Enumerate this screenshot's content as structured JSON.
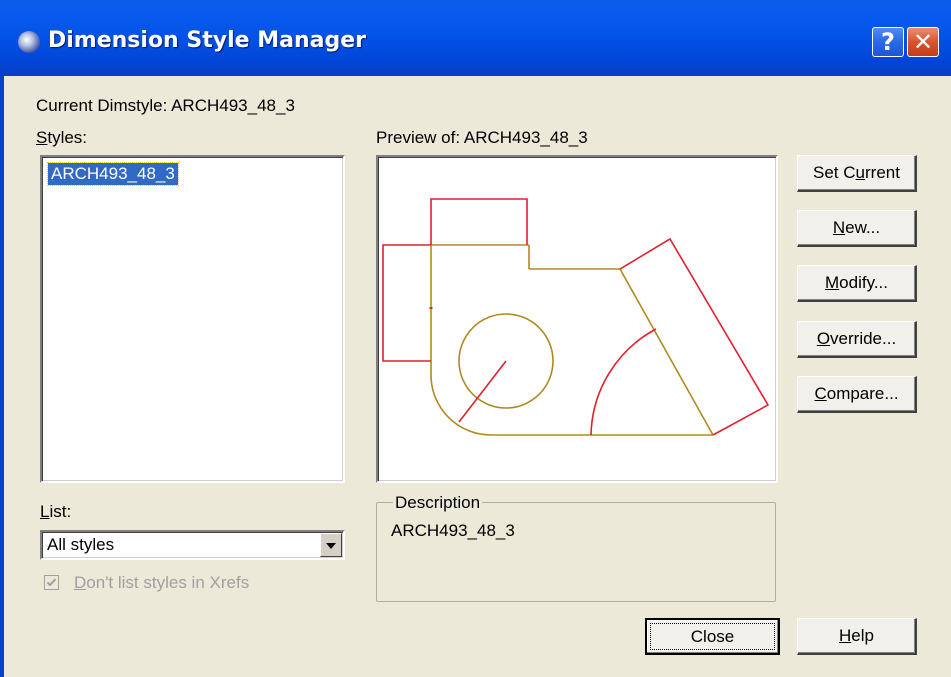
{
  "window": {
    "title": "Dimension Style Manager",
    "help_glyph": "?",
    "close_glyph": "✕"
  },
  "current_dimstyle_label": "Current Dimstyle: ARCH493_48_3",
  "styles": {
    "label_mnemonic": "S",
    "label_rest": "tyles:",
    "items": [
      "ARCH493_48_3"
    ]
  },
  "preview": {
    "label": "Preview of: ARCH493_48_3",
    "colors": {
      "geometry": "#b08a20",
      "dimension": "#e0202a"
    }
  },
  "list": {
    "label_mnemonic": "L",
    "label_rest": "ist:",
    "selected": "All styles"
  },
  "xrefs_checkbox": {
    "checked": true,
    "label_mnemonic": "D",
    "label_rest": "on't list styles in Xrefs"
  },
  "description": {
    "title": "Description",
    "value": "ARCH493_48_3"
  },
  "buttons": {
    "set_current_pre": "Set C",
    "set_current_mn": "u",
    "set_current_post": "rrent",
    "new_mn": "N",
    "new_rest": "ew...",
    "modify_mn": "M",
    "modify_rest": "odify...",
    "override_mn": "O",
    "override_rest": "verride...",
    "compare_mn": "C",
    "compare_rest": "ompare...",
    "close": "Close",
    "help_mn": "H",
    "help_rest": "elp"
  }
}
